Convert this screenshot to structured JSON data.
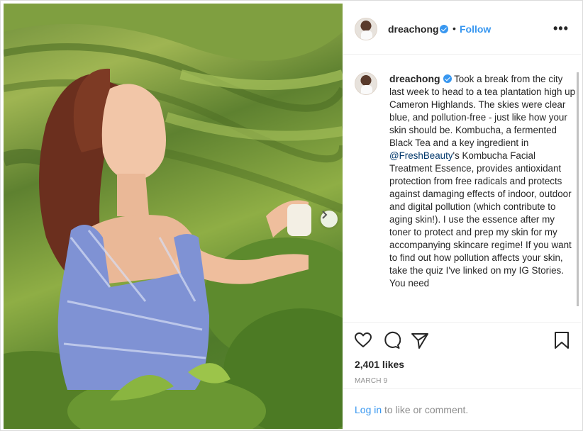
{
  "post": {
    "username": "dreachong",
    "dot": "•",
    "follow_label": "Follow",
    "more_label": "•••",
    "caption_pre": "Took a break from the city last week to head to a tea plantation high up Cameron Highlands. The skies were clear blue, and pollution-free - just like how your skin should be. Kombucha, a fermented Black Tea and a key ingredient in ",
    "caption_mention": "@FreshBeauty",
    "caption_post": "'s Kombucha Facial Treatment Essence, provides antioxidant protection from free radicals and protects against damaging effects of indoor, outdoor and digital pollution (which contribute to aging skin!). I use the essence after my toner to protect and prep my skin for my accompanying skincare regime! If you want to find out how pollution affects your skin, take the quiz I've linked on my IG Stories. You need",
    "likes": "2,401 likes",
    "date": "MARCH 9",
    "login_label": "Log in",
    "login_suffix": " to like or comment."
  },
  "icons": {
    "verified": "verified-badge-icon",
    "like": "heart-icon",
    "comment": "comment-bubble-icon",
    "share": "paper-plane-icon",
    "save": "bookmark-icon",
    "next": "chevron-right-icon",
    "more": "ellipsis-icon"
  },
  "colors": {
    "accent": "#3897f0",
    "mention": "#00376b",
    "muted": "#8e8e8e",
    "text": "#262626"
  }
}
